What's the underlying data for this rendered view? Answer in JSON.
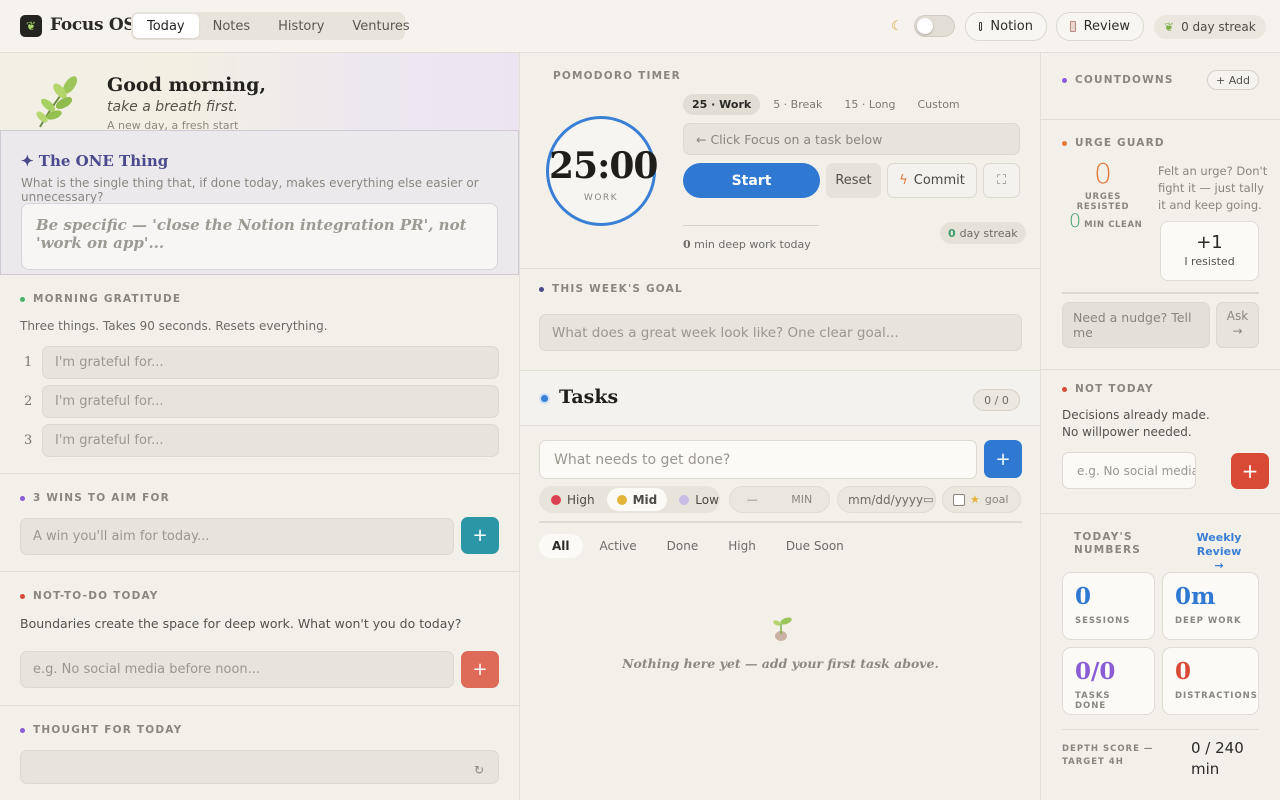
{
  "header": {
    "brand": "Focus OS",
    "tabs": [
      {
        "label": "Today",
        "active": true
      },
      {
        "label": "Notes",
        "active": false
      },
      {
        "label": "History",
        "active": false
      },
      {
        "label": "Ventures",
        "active": false
      }
    ],
    "notion_label": "Notion",
    "review_label": "Review",
    "streak_label": "0 day streak"
  },
  "greeting": {
    "title": "Good morning,",
    "subtitle": "take a breath first.",
    "tagline": "A new day, a fresh start"
  },
  "one_thing": {
    "title": "✦ The ONE Thing",
    "description": "What is the single thing that, if done today, makes everything else easier or unnecessary?",
    "placeholder": "Be specific — 'close the Notion integration PR', not 'work on app'..."
  },
  "gratitude": {
    "label": "MORNING GRATITUDE",
    "description": "Three things. Takes 90 seconds. Resets everything.",
    "items": [
      {
        "num": "1",
        "placeholder": "I'm grateful for..."
      },
      {
        "num": "2",
        "placeholder": "I'm grateful for..."
      },
      {
        "num": "3",
        "placeholder": "I'm grateful for..."
      }
    ]
  },
  "wins": {
    "label": "3 WINS TO AIM FOR",
    "placeholder": "A win you'll aim for today..."
  },
  "not_to_do": {
    "label": "NOT-TO-DO TODAY",
    "description": "Boundaries create the space for deep work. What won't you do today?",
    "placeholder": "e.g. No social media before noon..."
  },
  "thought": {
    "label": "THOUGHT FOR TODAY"
  },
  "pomodoro": {
    "label": "POMODORO TIMER",
    "time": "25:00",
    "phase": "WORK",
    "modes": [
      {
        "label": "25 · Work",
        "active": true
      },
      {
        "label": "5 · Break",
        "active": false
      },
      {
        "label": "15 · Long",
        "active": false
      },
      {
        "label": "Custom",
        "active": false
      }
    ],
    "task_hint": "← Click Focus on a task below",
    "start_label": "Start",
    "reset_label": "Reset",
    "commit_label": "Commit",
    "deep_work_value": "0",
    "deep_work_text": "min deep work today",
    "streak_value": "0",
    "streak_text": "day streak"
  },
  "week_goal": {
    "label": "THIS WEEK'S GOAL",
    "placeholder": "What does a great week look like? One clear goal..."
  },
  "tasks": {
    "title": "Tasks",
    "count": "0 / 0",
    "input_placeholder": "What needs to get done?",
    "priorities": [
      {
        "label": "High",
        "color": "#d9434f",
        "active": false
      },
      {
        "label": "Mid",
        "color": "#e4b43a",
        "active": true
      },
      {
        "label": "Low",
        "color": "#c9bde6",
        "active": false
      }
    ],
    "min_dash": "—",
    "min_unit": "MIN",
    "date_placeholder": "mm/dd/yyyy",
    "goal_label": "goal",
    "filters": [
      {
        "label": "All",
        "active": true
      },
      {
        "label": "Active",
        "active": false
      },
      {
        "label": "Done",
        "active": false
      },
      {
        "label": "High",
        "active": false
      },
      {
        "label": "Due Soon",
        "active": false
      }
    ],
    "empty_text": "Nothing here yet — add your first task above."
  },
  "countdowns": {
    "label": "COUNTDOWNS",
    "add_label": "+ Add"
  },
  "urge_guard": {
    "label": "URGE GUARD",
    "resisted_count": "0",
    "resisted_label": "URGES RESISTED",
    "min_clean_value": "0",
    "min_clean_label": "MIN CLEAN",
    "note": "Felt an urge? Don't fight it — just tally it and keep going.",
    "resist_plus": "+1",
    "resist_text": "I resisted",
    "nudge_placeholder": "Need a nudge? Tell me",
    "ask_label": "Ask",
    "ask_arrow": "→"
  },
  "not_today": {
    "label": "NOT TODAY",
    "description": "Decisions already made. No willpower needed.",
    "placeholder": "e.g. No social media be"
  },
  "numbers": {
    "label_line1": "TODAY'S",
    "label_line2": "NUMBERS",
    "weekly_review": "Weekly Review",
    "weekly_arrow": "→",
    "stats": [
      {
        "value": "0",
        "label": "SESSIONS",
        "color": "#2f79d3"
      },
      {
        "value": "0m",
        "label": "DEEP WORK",
        "color": "#2f79d3"
      },
      {
        "value": "0/0",
        "label": "TASKS DONE",
        "color": "#8a5cd6"
      },
      {
        "value": "0",
        "label": "DISTRACTIONS",
        "color": "#d84a36"
      }
    ],
    "depth_line1": "DEPTH SCORE —",
    "depth_line2": "TARGET 4H",
    "depth_value": "0 / 240 min"
  },
  "colors": {
    "accent_blue": "#2f79d3",
    "teal": "#2a96a6",
    "coral": "#de6b58",
    "red": "#d84a36"
  }
}
